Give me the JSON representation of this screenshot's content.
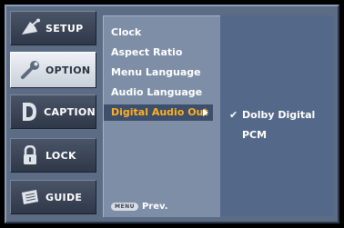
{
  "sidebar": {
    "items": [
      {
        "label": "SETUP",
        "icon": "satellite-dish-icon"
      },
      {
        "label": "OPTION",
        "icon": "wrench-icon"
      },
      {
        "label": "CAPTION",
        "icon": "caption-d-icon"
      },
      {
        "label": "LOCK",
        "icon": "padlock-icon"
      },
      {
        "label": "GUIDE",
        "icon": "guide-book-icon"
      }
    ],
    "selected": "OPTION"
  },
  "menu": {
    "items": [
      "Clock",
      "Aspect Ratio",
      "Menu Language",
      "Audio Language",
      "Digital Audio Out"
    ],
    "selected": "Digital Audio Out"
  },
  "submenu": {
    "options": [
      "Dolby Digital",
      "PCM"
    ],
    "checked": "Dolby Digital"
  },
  "hint": {
    "key": "MENU",
    "label": "Prev."
  },
  "colors": {
    "frame": "#5b6c84",
    "highlight_text": "#ffb020",
    "panel": "#7d8ea6",
    "subpanel": "#54698a"
  }
}
